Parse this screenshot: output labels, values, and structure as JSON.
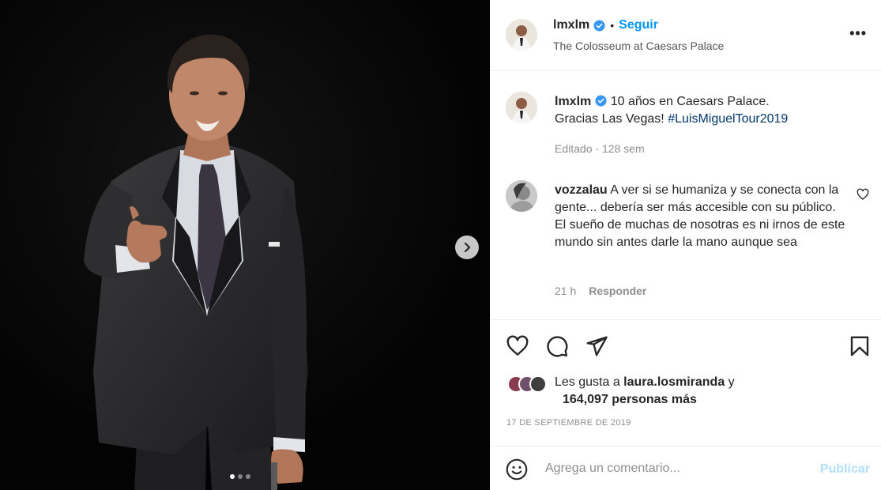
{
  "photo": {
    "carousel_index": 1,
    "carousel_total": 3
  },
  "header": {
    "username": "lmxlm",
    "separator": "•",
    "follow_label": "Seguir",
    "location": "The Colosseum at Caesars Palace",
    "more_label": "•••"
  },
  "caption": {
    "username": "lmxlm",
    "text_line1": " 10 años en Caesars Palace.",
    "text_line2": "Gracias Las Vegas! ",
    "hashtag": "#LuisMiguelTour2019",
    "edited": "Editado",
    "dot": "·",
    "age": "128 sem"
  },
  "comments": [
    {
      "username": "vozzalau",
      "text": " A ver si se humaniza y se conecta con la gente... debería ser más accesible con su público. El sueño de muchas de nosotras es ni irnos de este mundo sin antes darle la mano aunque sea",
      "age": "21 h",
      "reply_label": "Responder"
    }
  ],
  "likes": {
    "prefix": "Les gusta a ",
    "liker": "laura.losmiranda",
    "suffix": " y",
    "count_text": "164,097 personas más"
  },
  "date": "17 DE SEPTIEMBRE DE 2019",
  "comment_box": {
    "placeholder": "Agrega un comentario...",
    "publish_label": "Publicar"
  },
  "icons": {
    "verified": "verified-badge-icon",
    "next": "chevron-right-icon",
    "like": "heart-icon",
    "comment": "comment-bubble-icon",
    "share": "paper-plane-icon",
    "save": "bookmark-icon",
    "emoji": "smiley-icon"
  },
  "colors": {
    "accent": "#0095f6",
    "hashtag": "#00376b",
    "muted": "#8e8e8e",
    "publish_disabled": "#b2dffc",
    "verified": "#3897f0"
  }
}
